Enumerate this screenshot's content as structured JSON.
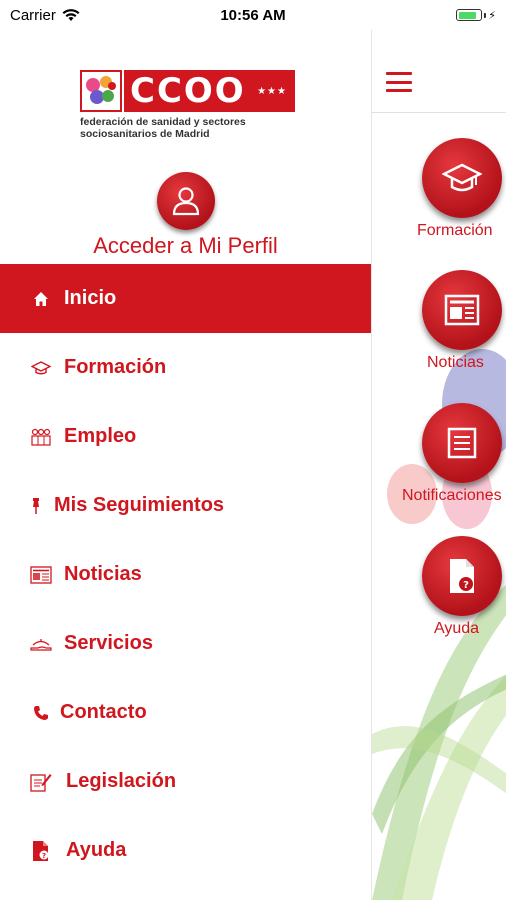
{
  "status_bar": {
    "carrier": "Carrier",
    "time": "10:56 AM",
    "battery_level": 0.8
  },
  "logo": {
    "text_line1": "federación de sanidad y sectores",
    "text_line2": "sociosanitarios de Madrid",
    "brand": "CCOO",
    "stars": "★★★\n★★★★"
  },
  "profile": {
    "label": "Acceder a Mi Perfil",
    "icon": "user-icon"
  },
  "menu": [
    {
      "label": "Inicio",
      "icon": "home-icon",
      "active": true
    },
    {
      "label": "Formación",
      "icon": "graduation-cap-icon"
    },
    {
      "label": "Empleo",
      "icon": "people-icon"
    },
    {
      "label": "Mis Seguimientos",
      "icon": "pin-icon"
    },
    {
      "label": "Noticias",
      "icon": "newspaper-icon"
    },
    {
      "label": "Servicios",
      "icon": "service-hand-icon"
    },
    {
      "label": "Contacto",
      "icon": "phone-icon"
    },
    {
      "label": "Legislación",
      "icon": "document-pen-icon"
    },
    {
      "label": "Ayuda",
      "icon": "help-document-icon"
    }
  ],
  "home_tiles": [
    {
      "label": "Formación",
      "icon": "graduation-cap-icon"
    },
    {
      "label": "Noticias",
      "icon": "newspaper-icon"
    },
    {
      "label": "Notificaciones",
      "icon": "list-icon"
    },
    {
      "label": "Ayuda",
      "icon": "help-document-icon"
    }
  ],
  "colors": {
    "brand_red": "#d0161e",
    "background": "#ffffff"
  }
}
